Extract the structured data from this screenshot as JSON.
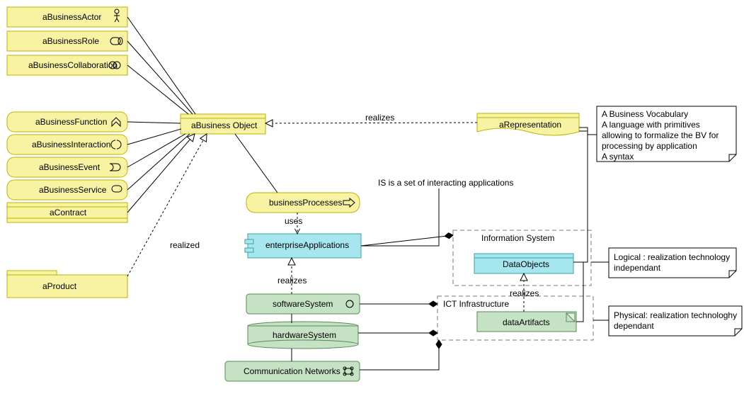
{
  "nodes": {
    "business_actor": {
      "label": "aBusinessActor"
    },
    "business_role": {
      "label": "aBusinessRole"
    },
    "business_collab": {
      "label": "aBusinessCollaboration"
    },
    "business_function": {
      "label": "aBusinessFunction"
    },
    "business_interaction": {
      "label": "aBusinessInteraction"
    },
    "business_event": {
      "label": "aBusinessEvent"
    },
    "business_service": {
      "label": "aBusinessService"
    },
    "contract": {
      "label": "aContract"
    },
    "product": {
      "label": "aProduct"
    },
    "business_object": {
      "label": "aBusiness Object"
    },
    "representation": {
      "label": "aRepresentation"
    },
    "business_processes": {
      "label": "businessProcesses"
    },
    "enterprise_apps": {
      "label": "enterpriseApplications"
    },
    "software_system": {
      "label": "softwareSystem"
    },
    "hardware_system": {
      "label": "hardwareSystem"
    },
    "comm_networks": {
      "label": "Communication Networks"
    },
    "data_objects": {
      "label": "DataObjects"
    },
    "data_artifacts": {
      "label": "dataArtifacts"
    }
  },
  "groups": {
    "information_system": {
      "label": "Information System"
    },
    "ict_infrastructure": {
      "label": "ICT Infrastructure"
    }
  },
  "notes": {
    "repr_note": {
      "lines": [
        "A Business Vocabulary",
        "A language with primitives",
        "allowing to formalize the BV for",
        "processing by application",
        "A syntax"
      ]
    },
    "logical_note": {
      "lines": [
        "Logical : realization technology",
        "independant"
      ]
    },
    "physical_note": {
      "lines": [
        "Physical: realization technologhy",
        "dependant"
      ]
    },
    "is_note": {
      "label": "IS is a set of interacting applications"
    }
  },
  "edge_labels": {
    "realizes_repr_bo": "realizes",
    "realized_bo_prod": "realized",
    "uses": "uses",
    "realizes_sw_ea": "realizes",
    "realizes_da_do": "realizes"
  },
  "colors": {
    "yellow": "#f8f3a3",
    "yellow_stroke": "#bdb300",
    "cyan": "#a6e6ee",
    "cyan_stroke": "#40a0a8",
    "green": "#c6e2c4",
    "green_stroke": "#5a8a58",
    "note": "#ffffff",
    "stroke": "#000000",
    "dash": "#777"
  }
}
